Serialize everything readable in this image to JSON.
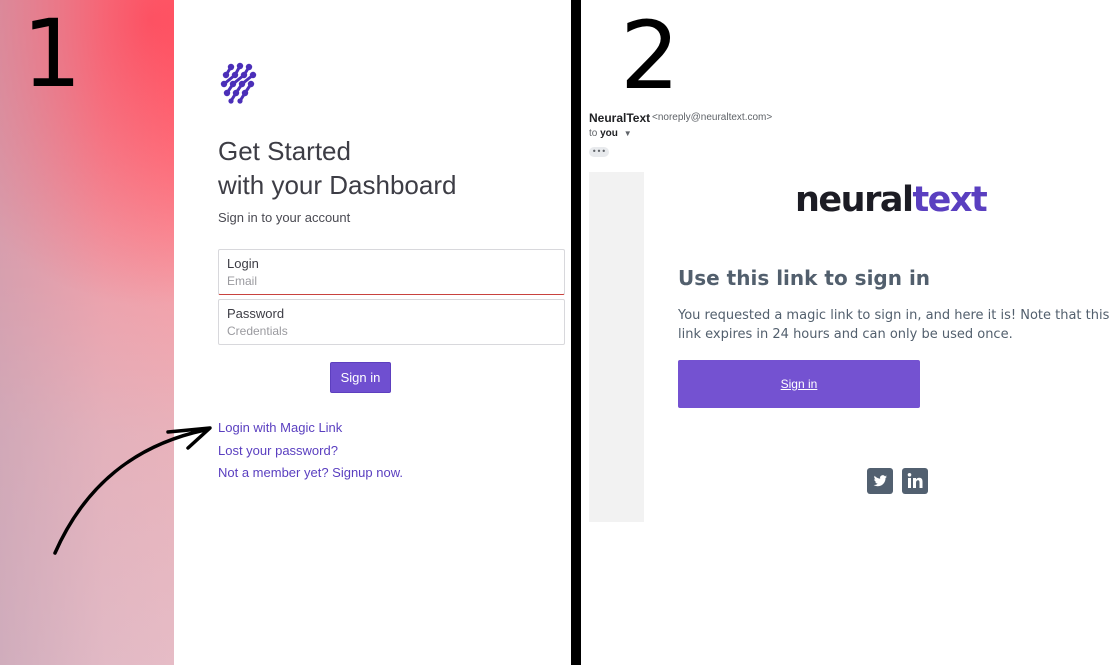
{
  "annotations": {
    "step_1": "1",
    "step_2": "2"
  },
  "login": {
    "title_line1": "Get Started",
    "title_line2": "with your Dashboard",
    "subtitle": "Sign in to your account",
    "login_label": "Login",
    "login_placeholder": "Email",
    "password_label": "Password",
    "password_placeholder": "Credentials",
    "signin_label": "Sign in",
    "links": {
      "magic": "Login with Magic Link",
      "lost": "Lost your password?",
      "signup": "Not a member yet? Signup now."
    },
    "logo_icon": "dots-hexagon-logo-icon",
    "accent_color": "#6f4fd0"
  },
  "email": {
    "sender_name": "NeuralText",
    "sender_email": "<noreply@neuraltext.com>",
    "to_prefix": "to",
    "to_name": "you",
    "more": "•••",
    "brand_part1": "neural",
    "brand_part2": "text",
    "heading": "Use this link to sign in",
    "body": "You requested a magic link to sign in, and here it is! Note that this link expires in 24 hours and can only be used once.",
    "button_label": "Sign in",
    "social_icons": [
      "twitter-icon",
      "linkedin-icon"
    ],
    "button_color": "#7452d1"
  }
}
